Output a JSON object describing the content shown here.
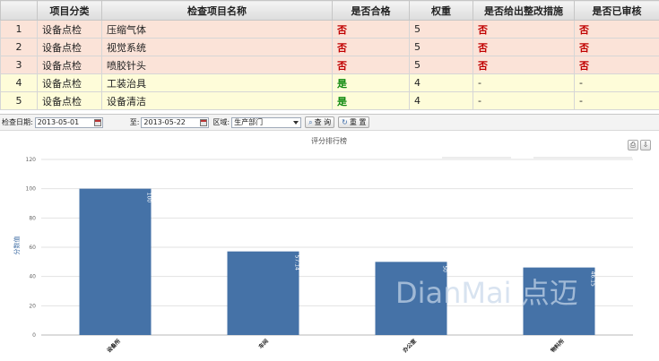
{
  "table": {
    "headers": [
      "项目分类",
      "检查项目名称",
      "是否合格",
      "权重",
      "是否给出整改措施",
      "是否已审核"
    ],
    "rows": [
      {
        "idx": "1",
        "category": "设备点检",
        "name": "压缩气体",
        "qualified": "否",
        "weight": "5",
        "rectify": "否",
        "audited": "否"
      },
      {
        "idx": "2",
        "category": "设备点检",
        "name": "视觉系统",
        "qualified": "否",
        "weight": "5",
        "rectify": "否",
        "audited": "否"
      },
      {
        "idx": "3",
        "category": "设备点检",
        "name": "喷胶针头",
        "qualified": "否",
        "weight": "5",
        "rectify": "否",
        "audited": "否"
      },
      {
        "idx": "4",
        "category": "设备点检",
        "name": "工装治具",
        "qualified": "是",
        "weight": "4",
        "rectify": "-",
        "audited": "-"
      },
      {
        "idx": "5",
        "category": "设备点检",
        "name": "设备清洁",
        "qualified": "是",
        "weight": "4",
        "rectify": "-",
        "audited": "-"
      }
    ]
  },
  "toolbar": {
    "date_label": "检查日期:",
    "start_date": "2013-05-01",
    "to_label": "至:",
    "end_date": "2013-05-22",
    "area_label": "区域:",
    "area_value": "生产部门",
    "query_label": "查 询",
    "reset_label": "重 置"
  },
  "chart_controls": {
    "print_icon": "print-icon",
    "export_icon": "export-icon"
  },
  "chart_data": {
    "type": "bar",
    "title": "评分排行榜",
    "ylabel": "分数值",
    "categories": [
      "设备所",
      "车间",
      "办公室",
      "物料所"
    ],
    "values": [
      100,
      57.14,
      50,
      46.15
    ],
    "value_labels": [
      "100",
      "57.14",
      "50",
      "46.15"
    ],
    "yticks": [
      0,
      20,
      40,
      60,
      80,
      100,
      120
    ],
    "ylim": [
      0,
      120
    ],
    "grid": true,
    "bar_color": "#4572a7"
  },
  "watermark": "DianMai 点迈"
}
